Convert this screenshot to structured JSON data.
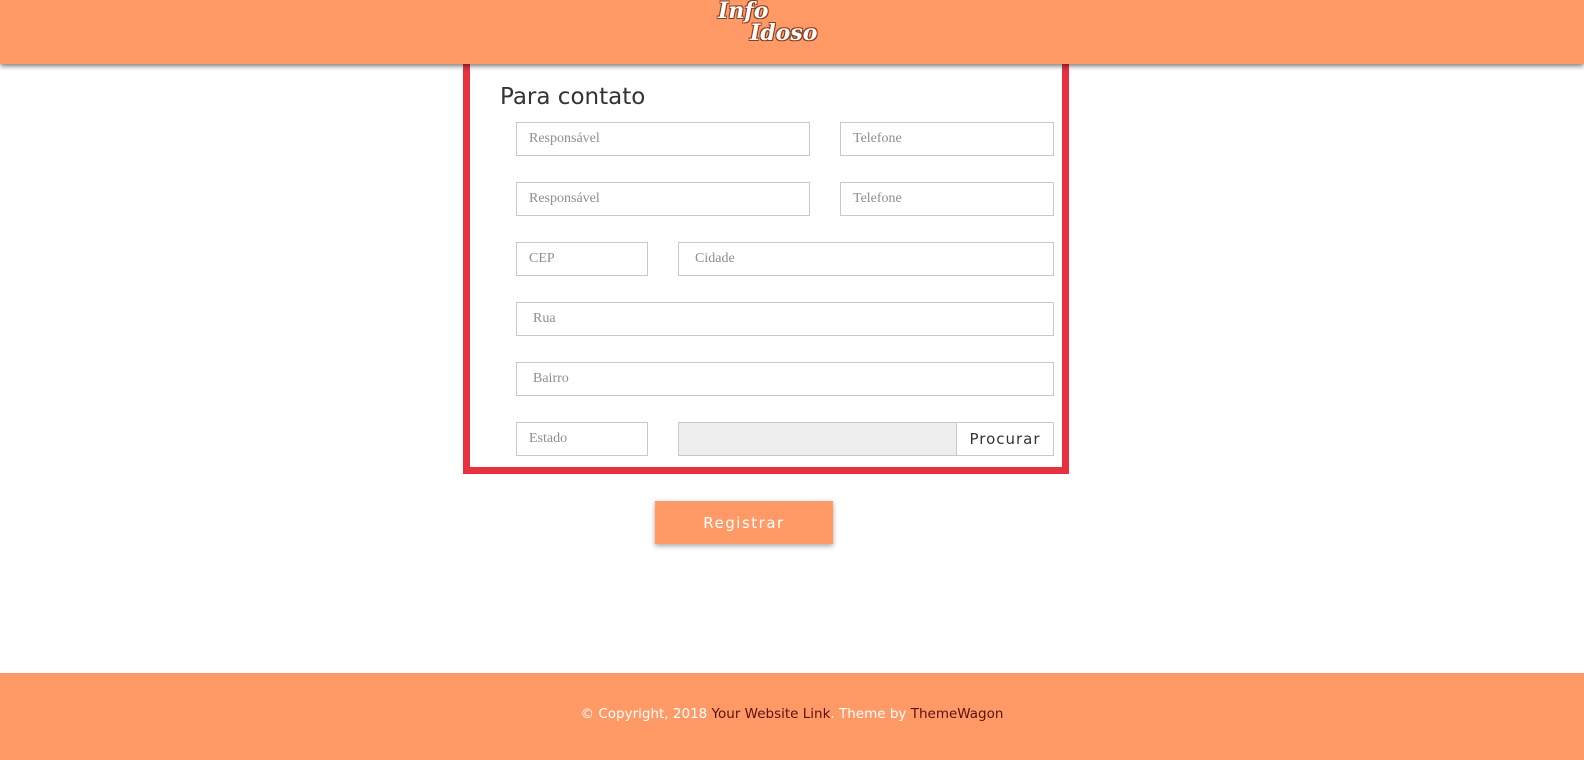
{
  "header": {
    "logo_line1": "Info",
    "logo_line2": "Idoso"
  },
  "form": {
    "section_title": "Para contato",
    "responsavel_1_placeholder": "Responsável",
    "telefone_1_placeholder": "Telefone",
    "responsavel_2_placeholder": "Responsável",
    "telefone_2_placeholder": "Telefone",
    "cep_placeholder": "CEP",
    "cidade_placeholder": "Cidade",
    "rua_placeholder": "Rua",
    "bairro_placeholder": "Bairro",
    "estado_placeholder": "Estado",
    "search_button_label": "Procurar"
  },
  "register_button_label": "Registrar",
  "footer": {
    "copyright_text": "© Copyright, 2018",
    "website_link_label": "Your Website Link",
    "theme_by_text": ". Theme by",
    "theme_link_label": "ThemeWagon"
  },
  "colors": {
    "accent": "#ff9966",
    "form_border": "#e8313f",
    "footer_link": "#5a1010"
  }
}
